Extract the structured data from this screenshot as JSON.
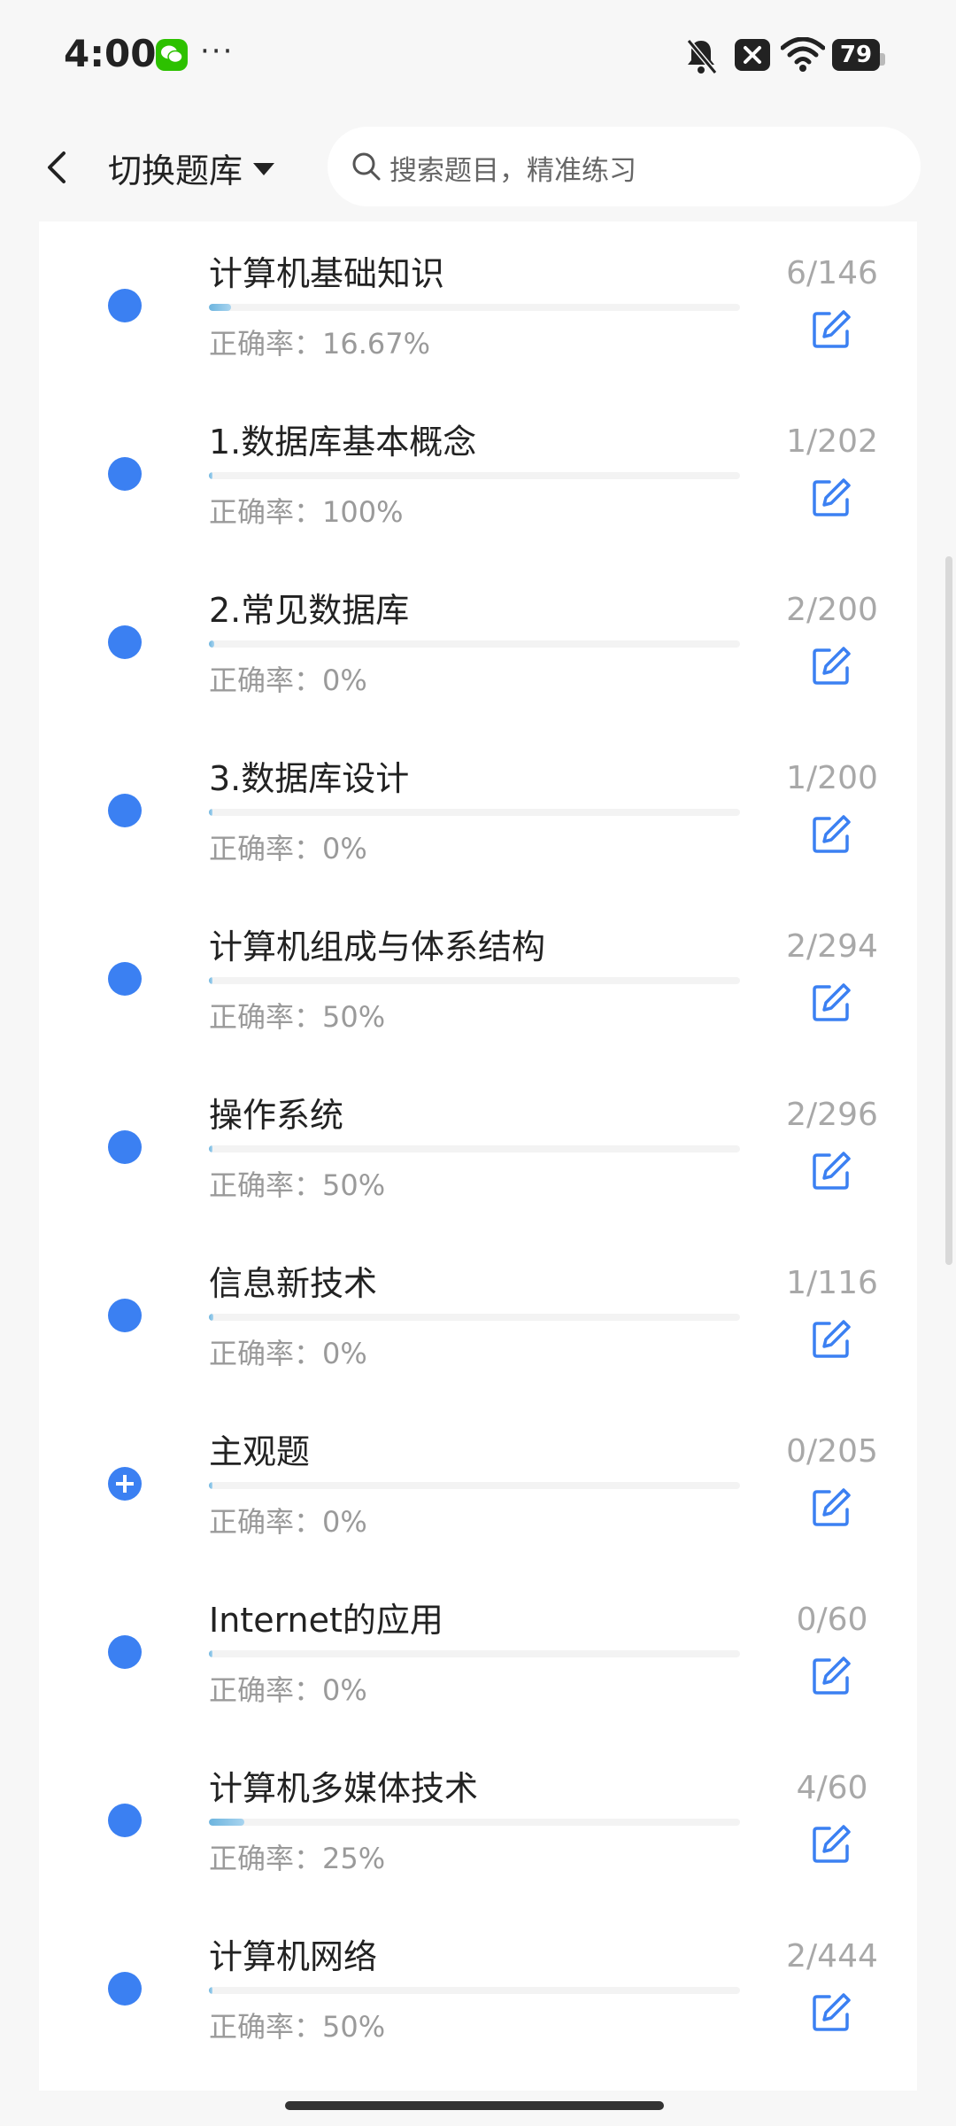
{
  "status_bar": {
    "time": "4:00",
    "more": "···",
    "battery": "79",
    "icons": [
      "wechat-icon",
      "mute-icon",
      "close-box-icon",
      "wifi-icon",
      "battery-icon"
    ]
  },
  "header": {
    "switch_label": "切换题库",
    "search_placeholder": "搜索题目，精准练习"
  },
  "colors": {
    "accent": "#3b80f2",
    "progress": "#6cb4de",
    "muted": "#a8a8a8"
  },
  "items": [
    {
      "title": "计算机基础知识",
      "accuracy": "正确率：16.67%",
      "count": "6/146",
      "progress": 0.041,
      "icon": "dot"
    },
    {
      "title": "1.数据库基本概念",
      "accuracy": "正确率：100%",
      "count": "1/202",
      "progress": 0.005,
      "icon": "dot"
    },
    {
      "title": "2.常见数据库",
      "accuracy": "正确率：0%",
      "count": "2/200",
      "progress": 0.01,
      "icon": "dot"
    },
    {
      "title": "3.数据库设计",
      "accuracy": "正确率：0%",
      "count": "1/200",
      "progress": 0.005,
      "icon": "dot"
    },
    {
      "title": "计算机组成与体系结构",
      "accuracy": "正确率：50%",
      "count": "2/294",
      "progress": 0.007,
      "icon": "dot"
    },
    {
      "title": "操作系统",
      "accuracy": "正确率：50%",
      "count": "2/296",
      "progress": 0.007,
      "icon": "dot"
    },
    {
      "title": "信息新技术",
      "accuracy": "正确率：0%",
      "count": "1/116",
      "progress": 0.009,
      "icon": "dot"
    },
    {
      "title": "主观题",
      "accuracy": "正确率：0%",
      "count": "0/205",
      "progress": 0,
      "icon": "plus"
    },
    {
      "title": "Internet的应用",
      "accuracy": "正确率：0%",
      "count": "0/60",
      "progress": 0,
      "icon": "dot"
    },
    {
      "title": "计算机多媒体技术",
      "accuracy": "正确率：25%",
      "count": "4/60",
      "progress": 0.067,
      "icon": "dot"
    },
    {
      "title": "计算机网络",
      "accuracy": "正确率：50%",
      "count": "2/444",
      "progress": 0.005,
      "icon": "dot"
    }
  ]
}
